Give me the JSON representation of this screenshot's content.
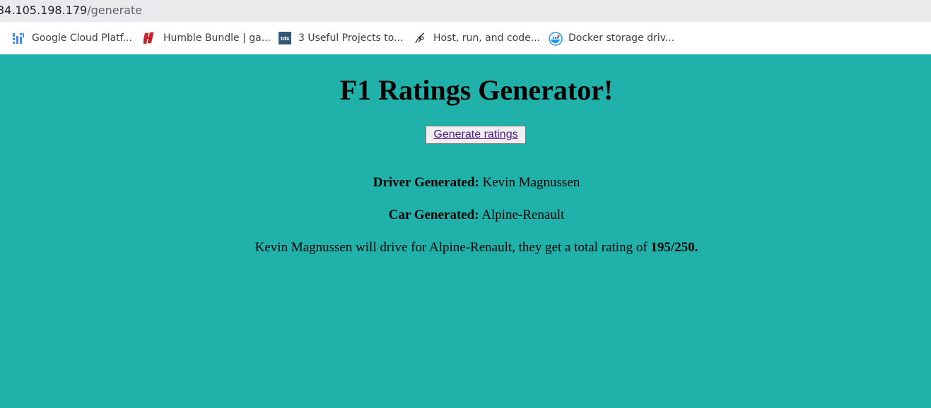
{
  "address": {
    "host": "34.105.198.179",
    "path": "/generate"
  },
  "bookmarks": [
    {
      "label": "Google Cloud Platf...",
      "icon": "google-cloud-icon"
    },
    {
      "label": "Humble Bundle | ga...",
      "icon": "humble-bundle-icon"
    },
    {
      "label": "3 Useful Projects to...",
      "icon": "tds-icon"
    },
    {
      "label": "Host, run, and code...",
      "icon": "replit-icon"
    },
    {
      "label": "Docker storage driv...",
      "icon": "docker-icon"
    }
  ],
  "page": {
    "title": "F1 Ratings Generator!",
    "generate_label": "Generate ratings",
    "driver_label": "Driver Generated:",
    "driver_value": "Kevin Magnussen",
    "car_label": "Car Generated:",
    "car_value": "Alpine-Renault",
    "summary_text": "Kevin Magnussen will drive for Alpine-Renault, they get a total rating of",
    "summary_rating": "195/250."
  },
  "colors": {
    "background": "#20b2aa",
    "link": "#551a8b"
  }
}
